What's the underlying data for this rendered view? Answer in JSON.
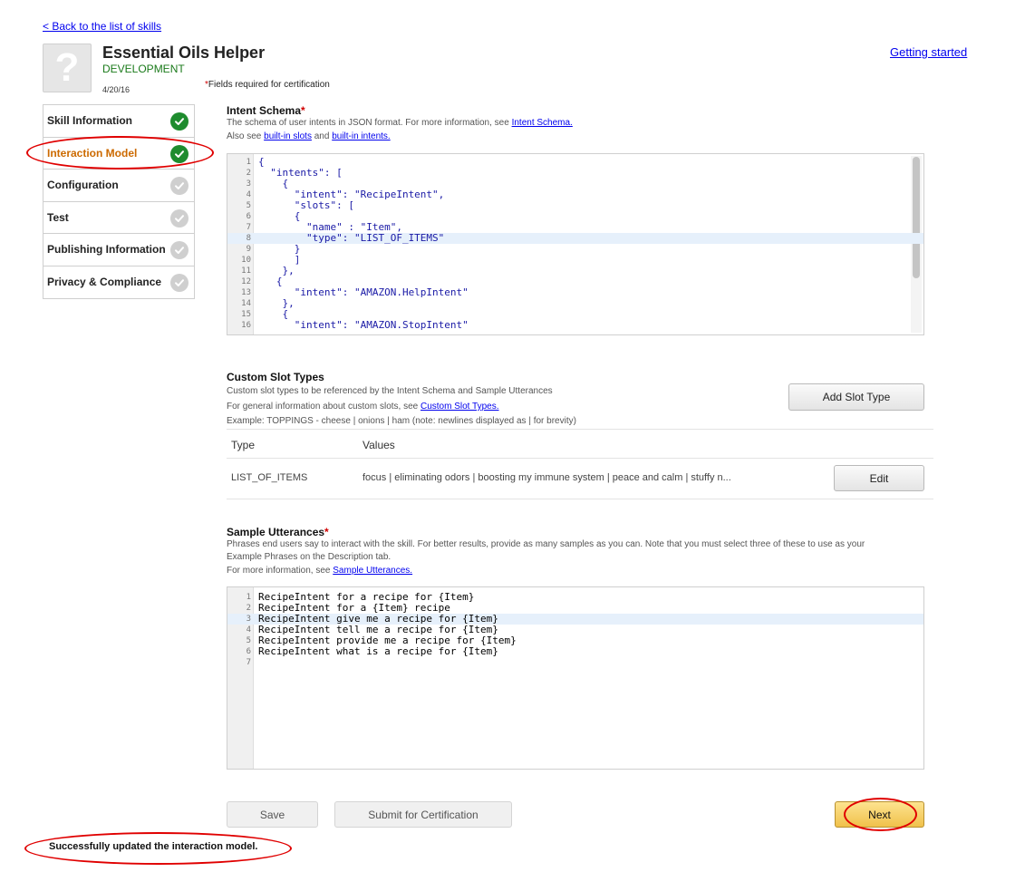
{
  "header": {
    "back_link": "< Back to the list of skills",
    "skill_name": "Essential Oils Helper",
    "stage": "DEVELOPMENT",
    "date": "4/20/16",
    "required_star": "*",
    "required_note": "Fields required for certification",
    "getting_started": "Getting started",
    "icon_glyph": "?"
  },
  "sidebar": {
    "items": [
      {
        "label": "Skill Information",
        "complete": true
      },
      {
        "label": "Interaction Model",
        "complete": true,
        "active": true
      },
      {
        "label": "Configuration",
        "complete": false
      },
      {
        "label": "Test",
        "complete": false
      },
      {
        "label": "Publishing Information",
        "complete": false
      },
      {
        "label": "Privacy & Compliance",
        "complete": false
      }
    ]
  },
  "intent_schema": {
    "title": "Intent Schema",
    "star": "*",
    "desc_prefix": "The schema of user intents in JSON format. For more information, see ",
    "desc_link": "Intent Schema.",
    "also_prefix": "Also see ",
    "slots_link": "built-in slots",
    "and_text": " and ",
    "intents_link": "built-in intents.",
    "highlighted_line": 8,
    "lines": [
      "{",
      "  \"intents\": [",
      "    {",
      "      \"intent\": \"RecipeIntent\",",
      "      \"slots\": [",
      "      {",
      "        \"name\" : \"Item\",",
      "        \"type\": \"LIST_OF_ITEMS\"",
      "      }",
      "      ]",
      "    },",
      "   {",
      "      \"intent\": \"AMAZON.HelpIntent\"",
      "    },",
      "    {",
      "      \"intent\": \"AMAZON.StopIntent\""
    ]
  },
  "custom_slots": {
    "title": "Custom Slot Types",
    "desc1": "Custom slot types to be referenced by the Intent Schema and Sample Utterances",
    "desc2_prefix": "For general information about custom slots, see ",
    "desc2_link": "Custom Slot Types.",
    "example": "Example: TOPPINGS - cheese | onions | ham (note: newlines displayed as | for brevity)",
    "add_button": "Add Slot Type",
    "col_type": "Type",
    "col_values": "Values",
    "rows": [
      {
        "type": "LIST_OF_ITEMS",
        "values": "focus | eliminating odors | boosting my immune system | peace and calm | stuffy n...",
        "edit": "Edit"
      }
    ]
  },
  "sample_utterances": {
    "title": "Sample Utterances",
    "star": "*",
    "desc1": "Phrases end users say to interact with the skill. For better results, provide as many samples as you can. Note that you must select three of these to use as your",
    "desc2": "Example Phrases on the Description tab.",
    "desc3_prefix": "For more information, see ",
    "desc3_link": "Sample Utterances.",
    "highlighted_line": 3,
    "lines": [
      "RecipeIntent for a recipe for {Item}",
      "RecipeIntent for a {Item} recipe",
      "RecipeIntent give me a recipe for {Item}",
      "RecipeIntent tell me a recipe for {Item}",
      "RecipeIntent provide me a recipe for {Item}",
      "RecipeIntent what is a recipe for {Item}",
      ""
    ]
  },
  "actions": {
    "save": "Save",
    "submit": "Submit for Certification",
    "next": "Next"
  },
  "status_message": "Successfully updated the interaction model."
}
